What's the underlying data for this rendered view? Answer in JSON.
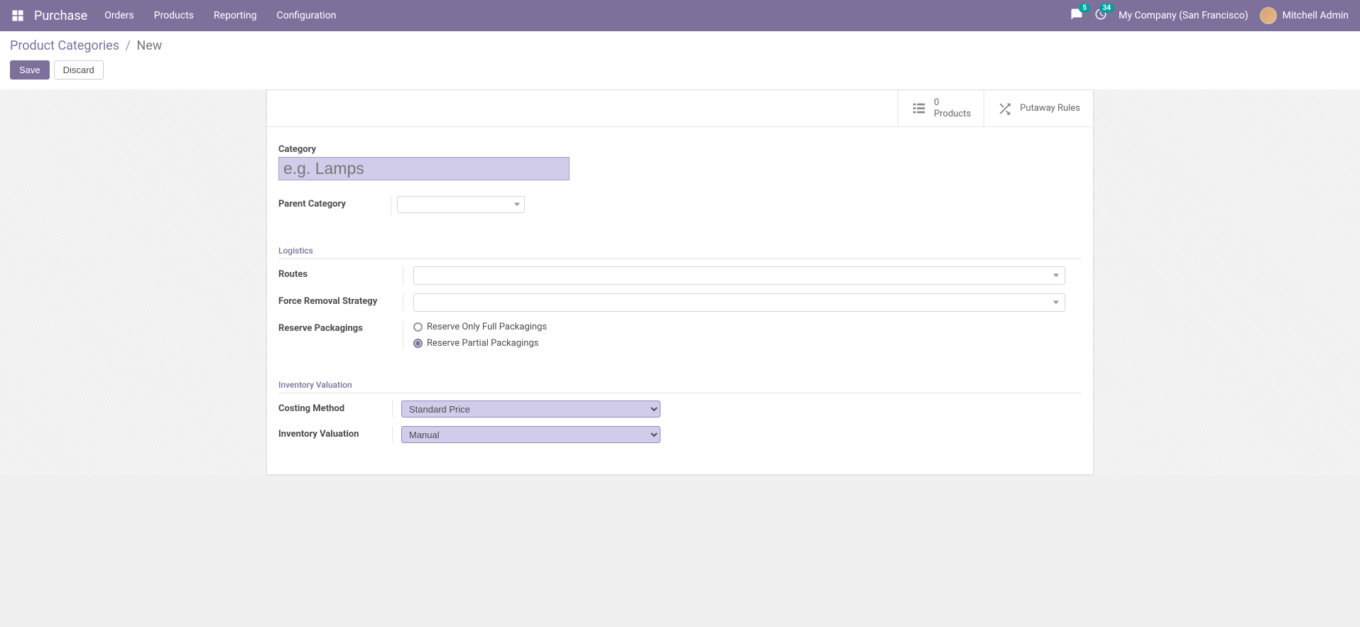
{
  "navbar": {
    "app_name": "Purchase",
    "menu": [
      "Orders",
      "Products",
      "Reporting",
      "Configuration"
    ],
    "messages_badge": "5",
    "activities_badge": "34",
    "company": "My Company (San Francisco)",
    "user": "Mitchell Admin"
  },
  "breadcrumb": {
    "parent": "Product Categories",
    "current": "New"
  },
  "buttons": {
    "save": "Save",
    "discard": "Discard"
  },
  "stats": {
    "products_count": "0",
    "products_label": "Products",
    "putaway_label": "Putaway Rules"
  },
  "form": {
    "category_label": "Category",
    "category_placeholder": "e.g. Lamps",
    "parent_category_label": "Parent Category",
    "parent_category_value": "",
    "sections": {
      "logistics": "Logistics",
      "inventory_valuation": "Inventory Valuation"
    },
    "routes_label": "Routes",
    "routes_value": "",
    "removal_label": "Force Removal Strategy",
    "removal_value": "",
    "reserve_label": "Reserve Packagings",
    "reserve_options": {
      "full": "Reserve Only Full Packagings",
      "partial": "Reserve Partial Packagings"
    },
    "reserve_selected": "partial",
    "costing_label": "Costing Method",
    "costing_value": "Standard Price",
    "valuation_label": "Inventory Valuation",
    "valuation_value": "Manual"
  }
}
